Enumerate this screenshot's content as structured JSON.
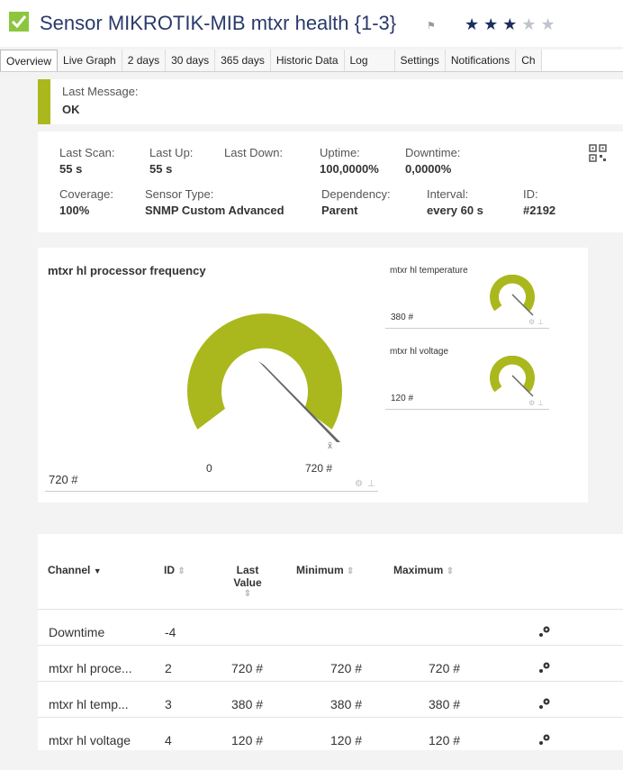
{
  "header": {
    "title": "Sensor MIKROTIK-MIB mtxr health {1-3}",
    "stars_on": "★★★",
    "stars_off": "★★",
    "flag_glyph": "⚑"
  },
  "tabs": [
    "Overview",
    "Live Graph",
    "2 days",
    "30 days",
    "365 days",
    "Historic Data",
    "Log",
    "Settings",
    "Notifications",
    "Ch"
  ],
  "message": {
    "label": "Last Message:",
    "value": "OK"
  },
  "stats": {
    "last_scan": {
      "label": "Last Scan:",
      "value": "55 s"
    },
    "last_up": {
      "label": "Last Up:",
      "value": "55 s"
    },
    "last_down": {
      "label": "Last Down:",
      "value": ""
    },
    "uptime": {
      "label": "Uptime:",
      "value": "100,0000%"
    },
    "downtime": {
      "label": "Downtime:",
      "value": "0,0000%"
    },
    "coverage": {
      "label": "Coverage:",
      "value": "100%"
    },
    "sensor_type": {
      "label": "Sensor Type:",
      "value": "SNMP Custom Advanced"
    },
    "dependency": {
      "label": "Dependency:",
      "value": "Parent"
    },
    "interval": {
      "label": "Interval:",
      "value": "every  60 s"
    },
    "id": {
      "label": "ID:",
      "value": "#2192"
    }
  },
  "gauges": {
    "main": {
      "title": "mtxr hl processor frequency",
      "value": "720 #",
      "min_label": "0",
      "max_label": "720 #",
      "max_symbol": "x̄"
    },
    "temperature": {
      "title": "mtxr hl temperature",
      "value": "380 #"
    },
    "voltage": {
      "title": "mtxr hl voltage",
      "value": "120 #"
    }
  },
  "table": {
    "headers": {
      "channel": "Channel",
      "id": "ID",
      "last_value_1": "Last",
      "last_value_2": "Value",
      "minimum": "Minimum",
      "maximum": "Maximum"
    },
    "rows": [
      {
        "channel": "Downtime",
        "id": "-4",
        "last": "",
        "min": "",
        "max": ""
      },
      {
        "channel": "mtxr hl proce...",
        "id": "2",
        "last": "720 #",
        "min": "720 #",
        "max": "720 #"
      },
      {
        "channel": "mtxr hl temp...",
        "id": "3",
        "last": "380 #",
        "min": "380 #",
        "max": "380 #"
      },
      {
        "channel": "mtxr hl voltage",
        "id": "4",
        "last": "120 #",
        "min": "120 #",
        "max": "120 #"
      }
    ]
  },
  "colors": {
    "gauge": "#aab81d",
    "needle": "#666666",
    "status_ok": "#8cc63f",
    "title": "#2a3a6a"
  }
}
